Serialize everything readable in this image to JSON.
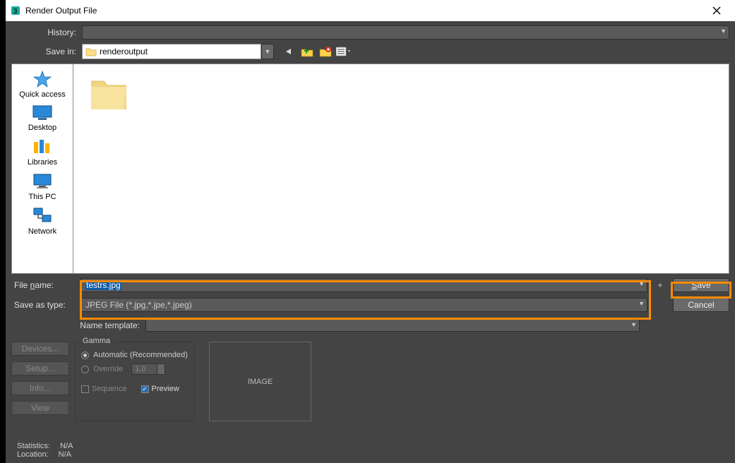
{
  "window": {
    "title": "Render Output File"
  },
  "history": {
    "label": "History:"
  },
  "savein": {
    "label": "Save in:",
    "value": "renderoutput"
  },
  "places": [
    {
      "key": "quick-access",
      "label": "Quick access"
    },
    {
      "key": "desktop",
      "label": "Desktop"
    },
    {
      "key": "libraries",
      "label": "Libraries"
    },
    {
      "key": "this-pc",
      "label": "This PC"
    },
    {
      "key": "network",
      "label": "Network"
    }
  ],
  "file_area": {
    "folder_label": ""
  },
  "fields": {
    "filename_label": "File name:",
    "filename_value": "testrs.jpg",
    "savetype_label": "Save as type:",
    "savetype_value": "JPEG File (*.jpg,*.jpe,*.jpeg)",
    "nametemplate_label": "Name template:"
  },
  "buttons": {
    "save": "Save",
    "cancel": "Cancel",
    "plus": "+",
    "devices": "Devices...",
    "setup": "Setup...",
    "info": "Info...",
    "view": "View"
  },
  "gamma": {
    "legend": "Gamma",
    "automatic": "Automatic (Recommended)",
    "override": "Override",
    "override_value": "1,0",
    "sequence": "Sequence",
    "preview": "Preview"
  },
  "image_box": "IMAGE",
  "stats": {
    "statistics_label": "Statistics:",
    "statistics_value": "N/A",
    "location_label": "Location:",
    "location_value": "N/A"
  }
}
